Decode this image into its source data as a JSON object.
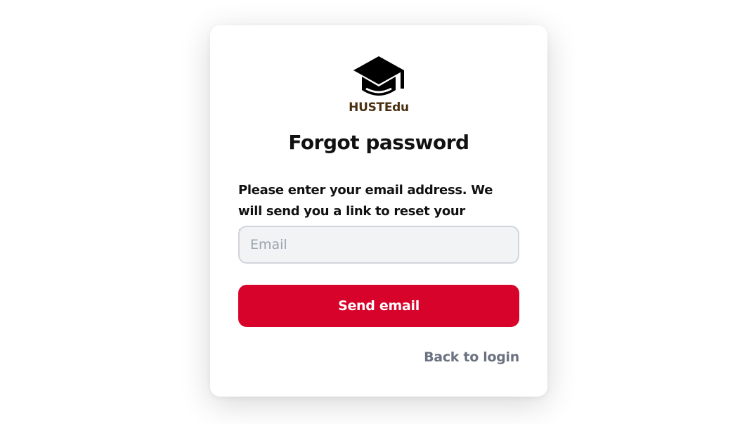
{
  "brand": {
    "name": "HUSTEdu",
    "logo_icon": "graduation-cap-icon",
    "name_color": "#4a3012"
  },
  "form": {
    "title": "Forgot password",
    "description": "Please enter your email address. We will send you a link to reset your password.",
    "email_placeholder": "Email",
    "email_value": "",
    "submit_label": "Send email",
    "back_link_label": "Back to login"
  },
  "colors": {
    "primary": "#d8032b",
    "link": "#6b7280",
    "input_bg": "#f2f3f5",
    "input_border": "#d1d5db"
  }
}
